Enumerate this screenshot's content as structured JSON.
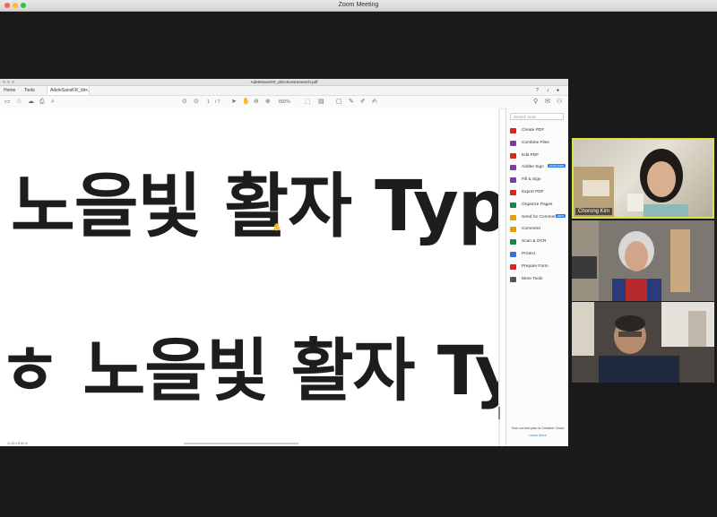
{
  "zoom": {
    "window_title": "Zoom Meeting"
  },
  "acrobat": {
    "file_title": "AdeleSansKR_directionsresearch.pdf",
    "tabs": {
      "home": "Home",
      "tools": "Tools",
      "doc": "AdeleSansKR_dir..."
    },
    "toolbar": {
      "page_current": "1",
      "page_total": "/ 7",
      "zoom_level": "800%"
    },
    "page": {
      "line1": "노을빛 활자 Typef",
      "line2": "ㅎ 노을빛 활자 Typ",
      "page_size": "11.00 x 8.50 in"
    },
    "right_panel": {
      "search_placeholder": "Search tools",
      "tools": [
        {
          "label": "Create PDF",
          "color": "#e1251b"
        },
        {
          "label": "Combine Files",
          "color": "#7a3ea8"
        },
        {
          "label": "Edit PDF",
          "color": "#e1251b"
        },
        {
          "label": "Adobe Sign",
          "color": "#7a3ea8",
          "badge": "FEATURED"
        },
        {
          "label": "Fill & Sign",
          "color": "#7a3ea8"
        },
        {
          "label": "Export PDF",
          "color": "#e1251b"
        },
        {
          "label": "Organize Pages",
          "color": "#0f8a4b"
        },
        {
          "label": "Send for Comments",
          "color": "#e0a100",
          "badge": "NEW"
        },
        {
          "label": "Comment",
          "color": "#e0a100"
        },
        {
          "label": "Scan & OCR",
          "color": "#0f8a4b"
        },
        {
          "label": "Protect",
          "color": "#3d6ee0"
        },
        {
          "label": "Prepare Form",
          "color": "#e1251b"
        },
        {
          "label": "More Tools",
          "color": "#555555"
        }
      ],
      "footer_text": "Your current plan is Creative Cloud",
      "footer_link": "Learn More"
    }
  },
  "participants": [
    {
      "name": "Chorong Kim",
      "active": true
    },
    {
      "name": "",
      "active": false
    },
    {
      "name": "",
      "active": false
    }
  ]
}
